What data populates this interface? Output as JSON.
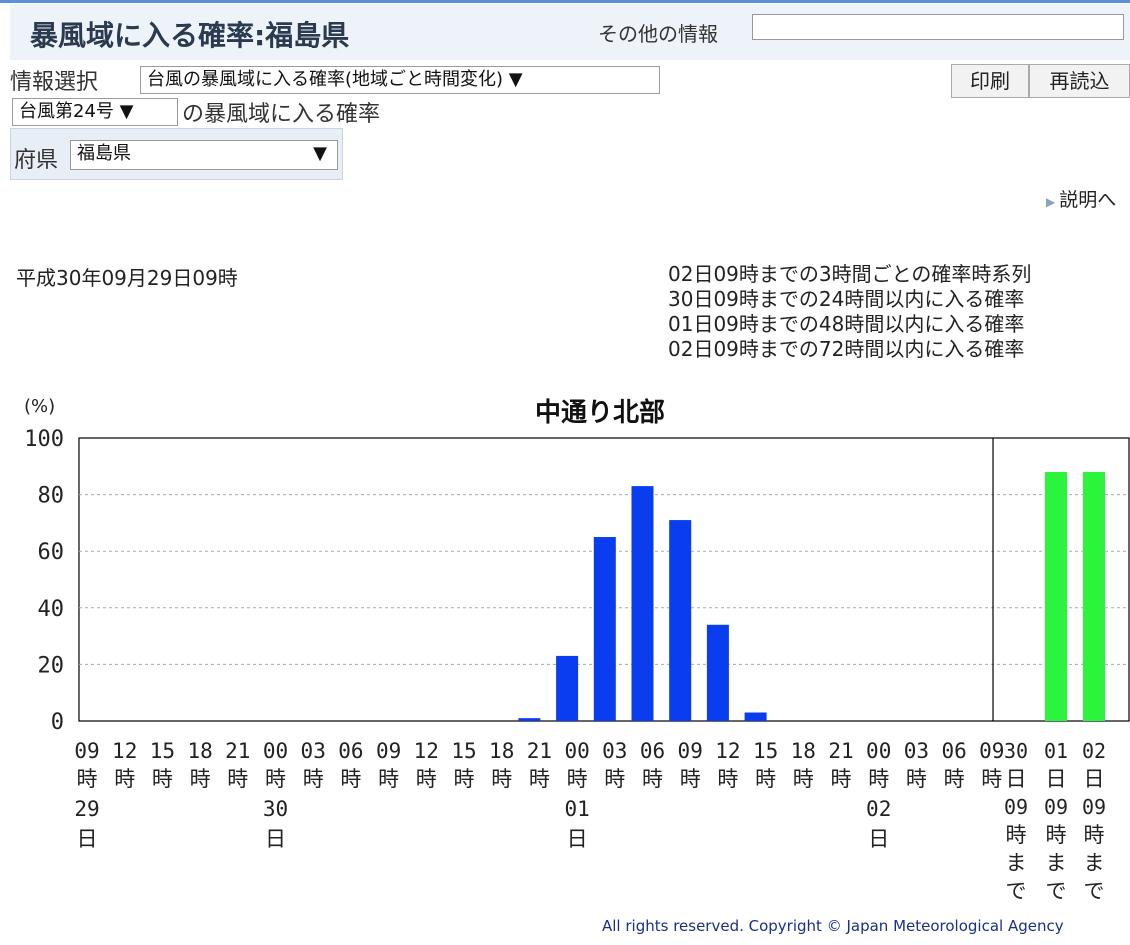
{
  "header": {
    "title": "暴風域に入る確率:福島県",
    "other_info_label": "その他の情報",
    "other_info_value": ""
  },
  "controls": {
    "info_select_label": "情報選択",
    "info_select_value": "台風の暴風域に入る確率(地域ごと時間変化) ▼",
    "typhoon_select_value": "台風第24号 ▼",
    "typhoon_suffix": "の暴風域に入る確率",
    "pref_label": "府県",
    "pref_select_value": "福島県",
    "pref_select_arrow": "▼",
    "print_button": "印刷",
    "reload_button": "再読込",
    "explanation_link": "説明へ"
  },
  "info": {
    "issued": "平成30年09月29日09時",
    "legend": [
      "02日09時までの3時間ごとの確率時系列",
      "30日09時までの24時間以内に入る確率",
      "01日09時までの48時間以内に入る確率",
      "02日09時までの72時間以内に入る確率"
    ]
  },
  "footer": {
    "copyright": "All rights reserved. Copyright © Japan Meteorological Agency"
  },
  "colors": {
    "series_3h": "#0a3cf0",
    "series_cumulative": "#2bf43c",
    "grid": "#aaaaaa"
  },
  "chart_data": {
    "type": "bar",
    "title": "中通り北部",
    "ylabel": "(%)",
    "ylim": [
      0,
      100
    ],
    "yticks": [
      0,
      20,
      40,
      60,
      80,
      100
    ],
    "grid": true,
    "hours": [
      "09",
      "12",
      "15",
      "18",
      "21",
      "00",
      "03",
      "06",
      "09",
      "12",
      "15",
      "18",
      "21",
      "00",
      "03",
      "06",
      "09",
      "12",
      "15",
      "18",
      "21",
      "00",
      "03",
      "06",
      "09"
    ],
    "day_labels": [
      {
        "index": 0,
        "num": "29",
        "unit": "日"
      },
      {
        "index": 5,
        "num": "30",
        "unit": "日"
      },
      {
        "index": 13,
        "num": "01",
        "unit": "日"
      },
      {
        "index": 21,
        "num": "02",
        "unit": "日"
      }
    ],
    "series": [
      {
        "name": "3時間ごとの確率",
        "values": [
          0,
          0,
          0,
          0,
          0,
          0,
          0,
          0,
          0,
          0,
          0,
          1,
          23,
          65,
          83,
          71,
          34,
          3,
          0,
          0,
          0,
          0,
          0,
          0
        ]
      }
    ],
    "cumulative": {
      "labels": [
        [
          "30",
          "日",
          "09",
          "時",
          "ま",
          "で"
        ],
        [
          "01",
          "日",
          "09",
          "時",
          "ま",
          "で"
        ],
        [
          "02",
          "日",
          "09",
          "時",
          "ま",
          "で"
        ]
      ],
      "values": [
        0,
        88,
        88
      ]
    }
  }
}
